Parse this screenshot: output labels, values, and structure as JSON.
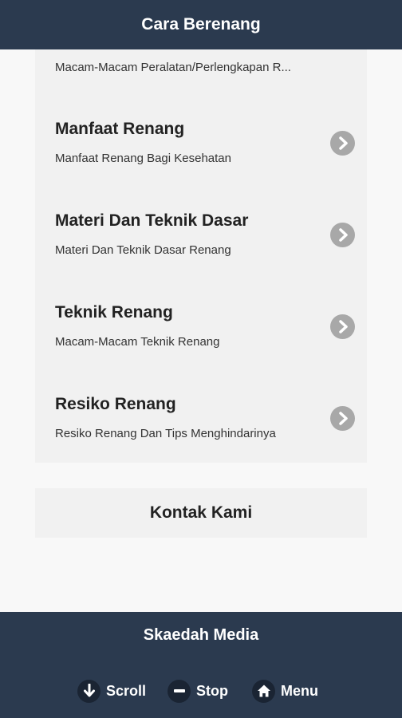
{
  "header": {
    "title": "Cara Berenang"
  },
  "menu": {
    "items": [
      {
        "title": "",
        "desc": "Macam-Macam Peralatan/Perlengkapan R..."
      },
      {
        "title": "Manfaat Renang",
        "desc": "Manfaat Renang Bagi Kesehatan"
      },
      {
        "title": "Materi Dan Teknik Dasar",
        "desc": "Materi Dan Teknik Dasar Renang"
      },
      {
        "title": "Teknik Renang",
        "desc": "Macam-Macam Teknik Renang"
      },
      {
        "title": "Resiko Renang",
        "desc": "Resiko Renang Dan Tips Menghindarinya"
      }
    ]
  },
  "contact": {
    "label": "Kontak Kami"
  },
  "footer": {
    "title": "Skaedah Media",
    "buttons": [
      {
        "label": "Scroll",
        "icon": "arrow-down-icon"
      },
      {
        "label": "Stop",
        "icon": "minus-icon"
      },
      {
        "label": "Menu",
        "icon": "home-icon"
      }
    ]
  },
  "colors": {
    "bar": "#2b3a4f",
    "card": "#f1f1f1",
    "arrow": "#a8a8a8"
  }
}
